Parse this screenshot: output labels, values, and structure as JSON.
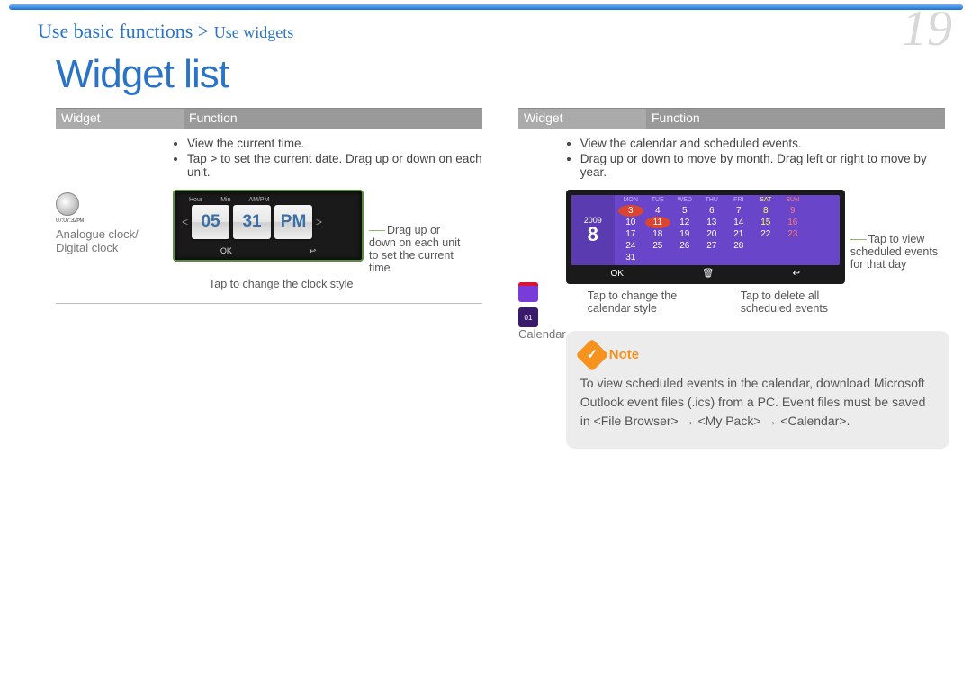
{
  "breadcrumb": {
    "main": "Use basic functions",
    "sub": "Use widgets"
  },
  "page_number": "19",
  "title": "Widget list",
  "table_head": {
    "col1": "Widget",
    "col2": "Function"
  },
  "left": {
    "widget_name": "Analogue clock/\nDigital clock",
    "bullets": [
      "View the current time.",
      "Tap > to set the current date. Drag up or down on each unit."
    ],
    "clock": {
      "labels": [
        "Hour",
        "Min",
        "AM/PM"
      ],
      "hour": "05",
      "min": "31",
      "ampm": "PM",
      "ok": "OK",
      "back": "↩"
    },
    "annot_right": "Drag up or down on each unit to set the current time",
    "annot_below": "Tap to change the clock style"
  },
  "right": {
    "widget_name": "Calendar",
    "bullets": [
      "View the calendar and scheduled events.",
      "Drag up or down to move by month. Drag left or right to move by year."
    ],
    "calendar": {
      "year": "2009",
      "big_day": "8",
      "dow": [
        "MON",
        "TUE",
        "WED",
        "THU",
        "FRI",
        "SAT",
        "SUN"
      ],
      "rows": [
        [
          "3",
          "4",
          "5",
          "6",
          "7",
          "8",
          "9"
        ],
        [
          "10",
          "11",
          "12",
          "13",
          "14",
          "15",
          "16"
        ],
        [
          "17",
          "18",
          "19",
          "20",
          "21",
          "22",
          "23"
        ],
        [
          "24",
          "25",
          "26",
          "27",
          "28",
          "",
          ""
        ],
        [
          "31",
          "",
          "",
          "",
          "",
          "",
          ""
        ]
      ],
      "ok": "OK",
      "del": "🗑",
      "back": "↩"
    },
    "annot_right": "Tap to view scheduled events for that day",
    "annot_below1": "Tap to change the calendar style",
    "annot_below2": "Tap to delete all scheduled events",
    "note_label": "Note",
    "note_body": "To view scheduled events in the calendar, download Microsoft Outlook event files (.ics) from a PC. Event files must be saved in <File Browser> → <My Pack> → <Calendar>."
  }
}
